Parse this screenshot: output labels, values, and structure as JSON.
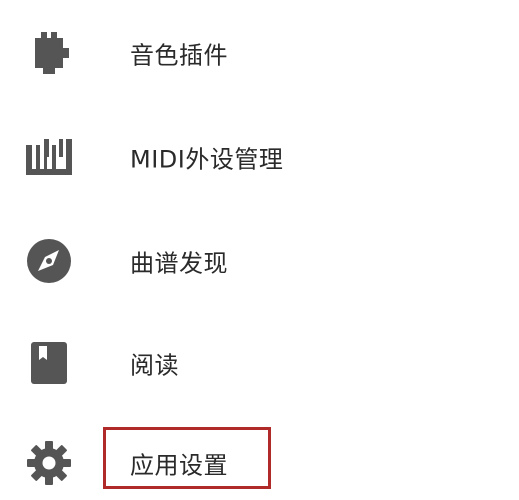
{
  "menu": {
    "items": [
      {
        "id": "plugins",
        "label": "音色插件",
        "icon": "puzzle-plugin-icon"
      },
      {
        "id": "midi",
        "label": "MIDI外设管理",
        "icon": "piano-keys-icon"
      },
      {
        "id": "discover",
        "label": "曲谱发现",
        "icon": "compass-icon"
      },
      {
        "id": "reading",
        "label": "阅读",
        "icon": "book-icon"
      },
      {
        "id": "settings",
        "label": "应用设置",
        "icon": "gear-icon"
      }
    ]
  },
  "colors": {
    "icon": "#555555",
    "text": "#2a2a2a",
    "highlight": "#b02a2a",
    "background": "#ffffff"
  }
}
